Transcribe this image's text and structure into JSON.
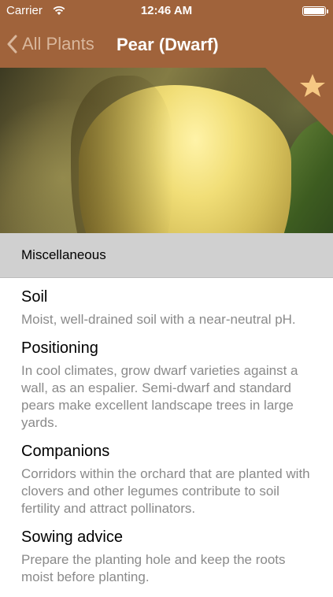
{
  "status_bar": {
    "carrier": "Carrier",
    "time": "12:46 AM"
  },
  "nav": {
    "back_label": "All Plants",
    "title": "Pear (Dwarf)"
  },
  "colors": {
    "header": "#a0633b",
    "section_bg": "#d0d0d0",
    "star": "#f6c883"
  },
  "section": {
    "title": "Miscellaneous"
  },
  "items": [
    {
      "title": "Soil",
      "text": "Moist, well-drained soil with a near-neutral pH."
    },
    {
      "title": "Positioning",
      "text": "In cool climates, grow dwarf varieties against a wall, as an espalier. Semi-dwarf and standard pears make excellent landscape trees in large yards."
    },
    {
      "title": "Companions",
      "text": "Corridors within the orchard that are planted with clovers and other legumes contribute to soil fertility and attract pollinators."
    },
    {
      "title": "Sowing advice",
      "text": "Prepare the planting hole and keep the roots moist before planting."
    }
  ]
}
